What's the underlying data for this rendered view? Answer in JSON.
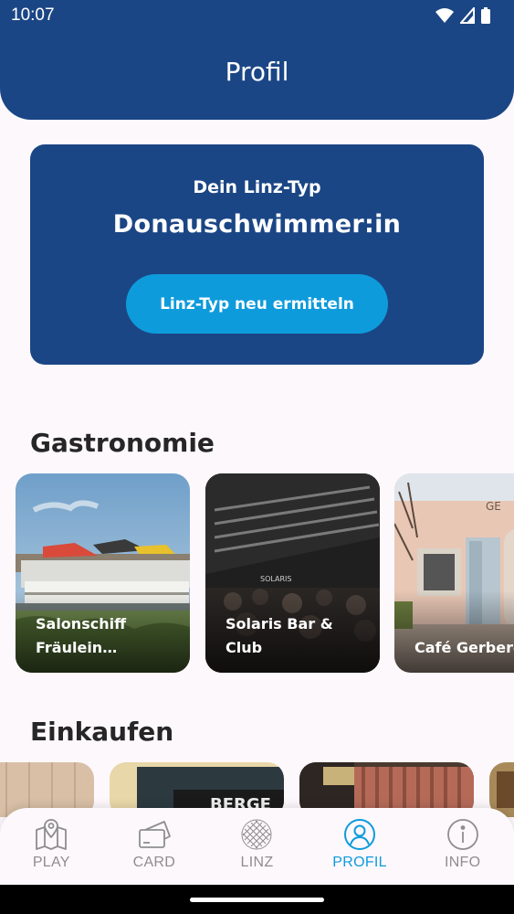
{
  "status_bar": {
    "time": "10:07"
  },
  "header": {
    "title": "Profil"
  },
  "linz_type": {
    "label": "Dein Linz-Typ",
    "value": "Donauschwimmer:in",
    "button_label": "Linz-Typ neu ermitteln"
  },
  "gastronomie": {
    "title": "Gastronomie",
    "items": [
      {
        "title": "Salonschiff Fräulein Florentine"
      },
      {
        "title": "Solaris Bar & Club"
      },
      {
        "title": "Café Gerberei"
      }
    ]
  },
  "einkaufen": {
    "title": "Einkaufen"
  },
  "bottom_nav": {
    "items": [
      {
        "label": "PLAY",
        "icon": "map-icon"
      },
      {
        "label": "CARD",
        "icon": "card-icon"
      },
      {
        "label": "LINZ",
        "icon": "globe-icon"
      },
      {
        "label": "PROFIL",
        "icon": "profile-icon"
      },
      {
        "label": "INFO",
        "icon": "info-icon"
      }
    ],
    "active": "PROFIL"
  },
  "colors": {
    "primary": "#1b4685",
    "accent": "#0e9bdc",
    "background": "#fdf8fc"
  }
}
